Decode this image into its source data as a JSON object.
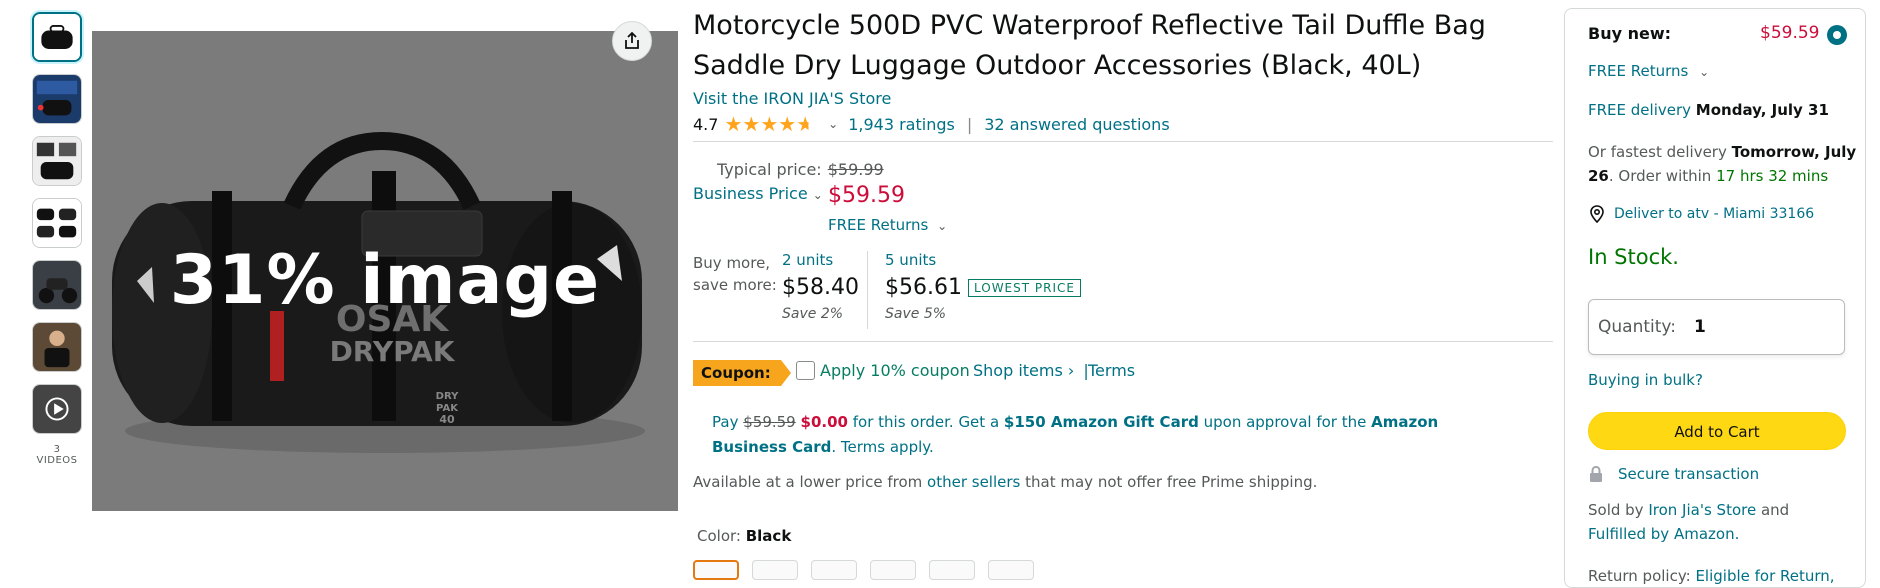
{
  "thumbnails": {
    "items": [
      "thumb-1",
      "thumb-2",
      "thumb-3",
      "thumb-4",
      "thumb-5",
      "thumb-6",
      "thumb-video"
    ],
    "videos_label": "3 VIDEOS"
  },
  "main_image": {
    "overlay_text": "31% image",
    "bag_brand": "OSAK",
    "bag_product": "DRYPAK",
    "bag_tag_line1": "DRY",
    "bag_tag_line2": "PAK",
    "bag_tag_line3": "40"
  },
  "product": {
    "title": "Motorcycle 500D PVC Waterproof Reflective Tail Duffle Bag Saddle Dry Luggage Outdoor Accessories (Black, 40L)",
    "store_link": "Visit the IRON JIA'S Store",
    "rating": "4.7",
    "ratings_count": "1,943 ratings",
    "answered": "32 answered questions"
  },
  "pricing": {
    "typical_label": "Typical price:",
    "typical_value": "$59.99",
    "business_label": "Business Price",
    "business_price": "$59.59",
    "free_returns": "FREE Returns",
    "bulk_label_1": "Buy more,",
    "bulk_label_2": "save more:",
    "tiers": [
      {
        "units": "2 units",
        "price": "$58.40",
        "save": "Save 2%"
      },
      {
        "units": "5 units",
        "price": "$56.61",
        "save": "Save 5%",
        "badge": "LOWEST PRICE"
      }
    ]
  },
  "coupon": {
    "badge": "Coupon:",
    "apply": "Apply 10% coupon",
    "shop_items": "Shop items ›",
    "divider": "|",
    "terms": "Terms"
  },
  "offer": {
    "pay": "Pay",
    "old_price": "$59.59",
    "new_price": "$0.00",
    "text1": "for this order. Get a",
    "gift": "$150 Amazon Gift Card",
    "text2": "upon approval for the",
    "card": "Amazon Business Card",
    "text3": ". Terms apply."
  },
  "lower_price": {
    "text1": "Available at a lower price from",
    "link": "other sellers",
    "text2": "that may not offer free Prime shipping."
  },
  "color": {
    "label": "Color:",
    "value": "Black"
  },
  "buybox": {
    "buy_new": "Buy new:",
    "price": "$59.59",
    "free_returns": "FREE Returns",
    "free_delivery": "FREE delivery",
    "delivery_date": "Monday, July 31",
    "fastest_pre": "Or fastest delivery",
    "fastest_date": "Tomorrow, July 26",
    "order_within": ". Order within",
    "time_left": "17 hrs 32 mins",
    "deliver_to": "Deliver to atv - Miami 33166",
    "in_stock": "In Stock.",
    "quantity_label": "Quantity:",
    "quantity_value": "1",
    "bulk": "Buying in bulk?",
    "add_to_cart": "Add to Cart",
    "secure": "Secure transaction",
    "sold_by": "Sold by",
    "seller": "Iron Jia's Store",
    "and": "and",
    "fulfilled": "Fulfilled by Amazon.",
    "return_policy": "Return policy:",
    "return_link": "Eligible for Return,"
  }
}
